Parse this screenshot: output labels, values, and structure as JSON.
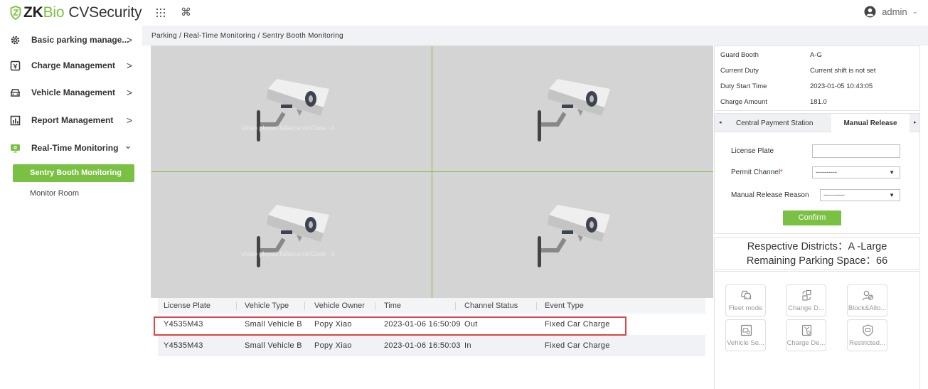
{
  "brand": {
    "zk": "ZK",
    "bio": "Bio",
    "product": "CVSecurity"
  },
  "header": {
    "user_name": "admin",
    "cmd_glyph": "⌘"
  },
  "sidebar": {
    "items": [
      {
        "label": "Basic parking manage...",
        "icon": "gear-icon",
        "arrow": ">"
      },
      {
        "label": "Charge Management",
        "icon": "receipt-icon",
        "arrow": ">"
      },
      {
        "label": "Vehicle Management",
        "icon": "car-icon",
        "arrow": ">"
      },
      {
        "label": "Report Management",
        "icon": "bar-chart-icon",
        "arrow": ">"
      },
      {
        "label": "Real-Time Monitoring",
        "icon": "monitor-icon",
        "arrow": "⌄"
      }
    ],
    "subitems": [
      {
        "label": "Sentry Booth Monitoring",
        "active": true
      },
      {
        "label": "Monitor Room",
        "active": false
      }
    ]
  },
  "breadcrumb": "Parking / Real-Time Monitoring / Sentry Booth Monitoring",
  "video": {
    "message": "Video played failed,errorCode: -1"
  },
  "table": {
    "headers": [
      "License Plate",
      "Vehicle Type",
      "Vehicle Owner",
      "Time",
      "Channel Status",
      "Event Type"
    ],
    "rows": [
      [
        "Y4535M43",
        "Small Vehicle B",
        "Popy Xiao",
        "2023-01-06 16:50:09",
        "Out",
        "Fixed Car Charge"
      ],
      [
        "Y4535M43",
        "Small Vehicle B",
        "Popy Xiao",
        "2023-01-06 16:50:03",
        "In",
        "Fixed Car Charge"
      ]
    ]
  },
  "booth_info": {
    "rows": [
      {
        "label": "Guard Booth",
        "value": "A-G"
      },
      {
        "label": "Current Duty",
        "value": "Current shift is not set"
      },
      {
        "label": "Duty Start Time",
        "value": "2023-01-05 10:43:05"
      },
      {
        "label": "Charge Amount",
        "value": "181.0"
      }
    ]
  },
  "tabs": {
    "left_arrow": "◂",
    "right_arrow": "▸",
    "central": "Central Payment Station",
    "manual": "Manual Release"
  },
  "manual_form": {
    "license_plate_label": "License Plate",
    "license_plate_value": "",
    "permit_channel_label": "Permit Channel",
    "permit_channel_required": "*",
    "permit_channel_value": "----------",
    "reason_label": "Manual Release Reason",
    "reason_value": "----------",
    "confirm_label": "Confirm"
  },
  "district": {
    "line1": "Respective Districts：A -Large",
    "line2": "Remaining Parking Space：66"
  },
  "tools": [
    {
      "label": "Fleet mode",
      "icon": "fleet-icon"
    },
    {
      "label": "Change D...",
      "icon": "change-device-icon"
    },
    {
      "label": "Block&Allo...",
      "icon": "block-allow-icon"
    },
    {
      "label": "Vehicle Se...",
      "icon": "vehicle-search-icon"
    },
    {
      "label": "Charge De...",
      "icon": "charge-detail-icon"
    },
    {
      "label": "Restricted...",
      "icon": "restricted-icon"
    }
  ],
  "colors": {
    "accent_green": "#7ac143",
    "highlight_red": "#e04444",
    "video_bg": "#d4d4d4"
  }
}
